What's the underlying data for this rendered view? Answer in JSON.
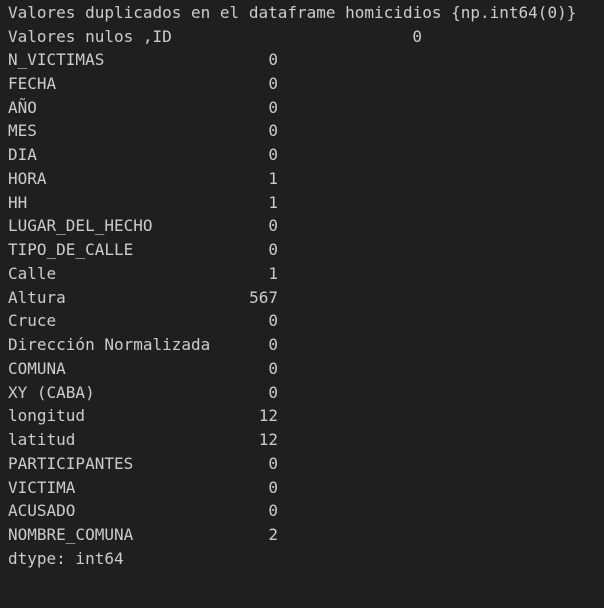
{
  "output": {
    "header_line": "Valores duplicados en el dataframe homicidios {np.int64(0)}",
    "nulls_title": "Valores nulos ,ID",
    "nulls_first_value": "0",
    "rows": [
      {
        "label": "N_VICTIMAS",
        "value": "0"
      },
      {
        "label": "FECHA",
        "value": "0"
      },
      {
        "label": "AÑO",
        "value": "0"
      },
      {
        "label": "MES",
        "value": "0"
      },
      {
        "label": "DIA",
        "value": "0"
      },
      {
        "label": "HORA",
        "value": "1"
      },
      {
        "label": "HH",
        "value": "1"
      },
      {
        "label": "LUGAR_DEL_HECHO",
        "value": "0"
      },
      {
        "label": "TIPO_DE_CALLE",
        "value": "0"
      },
      {
        "label": "Calle",
        "value": "1"
      },
      {
        "label": "Altura",
        "value": "567"
      },
      {
        "label": "Cruce",
        "value": "0"
      },
      {
        "label": "Dirección Normalizada",
        "value": "0"
      },
      {
        "label": "COMUNA",
        "value": "0"
      },
      {
        "label": "XY (CABA)",
        "value": "0"
      },
      {
        "label": "longitud",
        "value": "12"
      },
      {
        "label": "latitud",
        "value": "12"
      },
      {
        "label": "PARTICIPANTES",
        "value": "0"
      },
      {
        "label": "VICTIMA",
        "value": "0"
      },
      {
        "label": "ACUSADO",
        "value": "0"
      },
      {
        "label": "NOMBRE_COMUNA",
        "value": "2"
      }
    ],
    "dtype_line": "dtype: int64"
  }
}
